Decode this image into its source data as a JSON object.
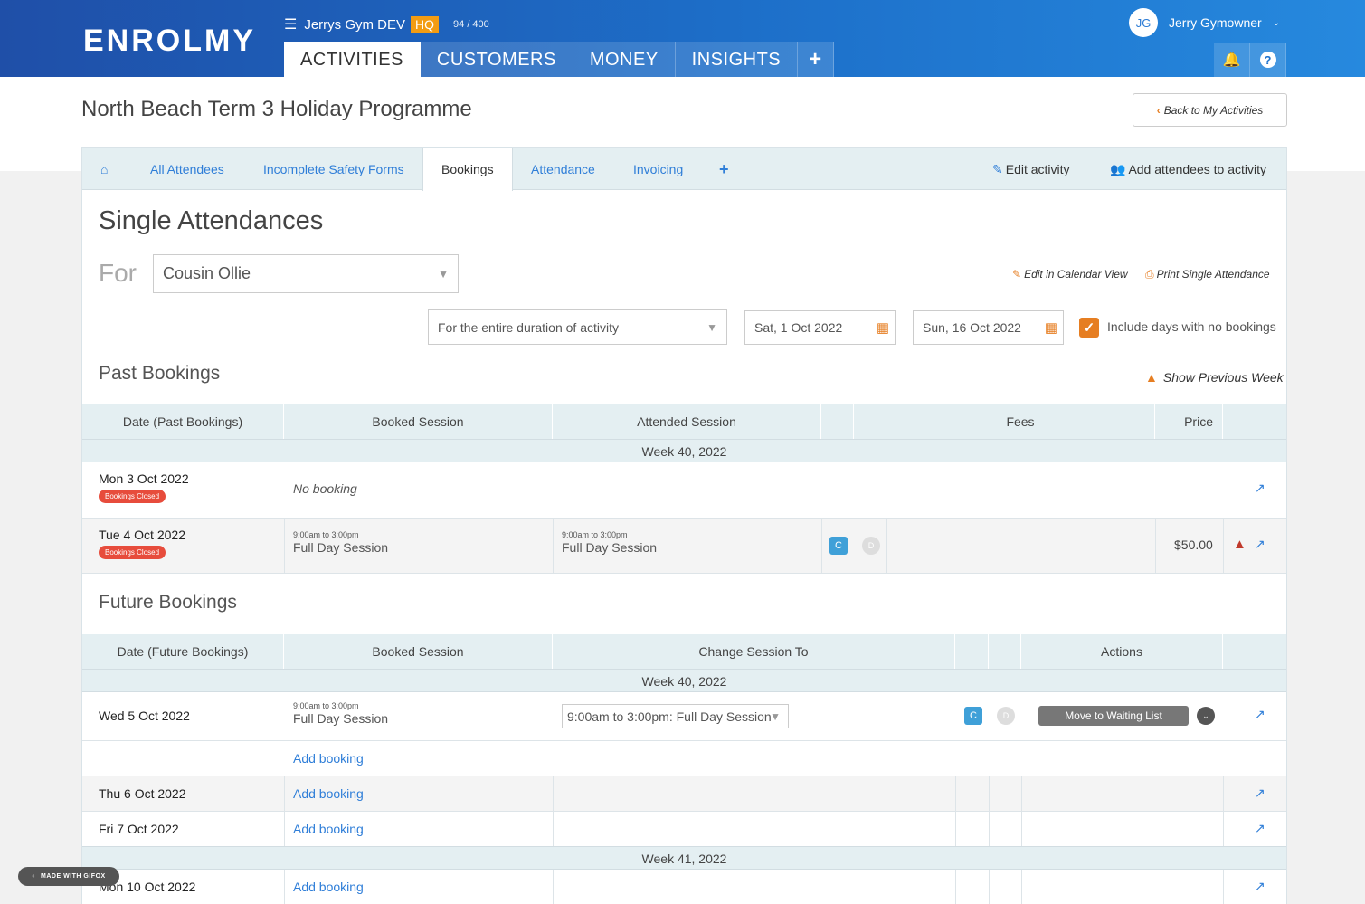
{
  "app": {
    "logo": "ENROLMY",
    "org_name": "Jerrys Gym DEV",
    "org_badge": "HQ",
    "org_count": "94 / 400",
    "nav_tabs": [
      {
        "label": "ACTIVITIES"
      },
      {
        "label": "CUSTOMERS"
      },
      {
        "label": "MONEY"
      },
      {
        "label": "INSIGHTS"
      }
    ],
    "nav_plus": "+",
    "user_initials": "JG",
    "user_name": "Jerry Gymowner",
    "help": "?"
  },
  "page": {
    "title": "North Beach Term 3 Holiday Programme",
    "back_label": "Back to My Activities"
  },
  "subtabs": {
    "items": [
      {
        "label": "All Attendees"
      },
      {
        "label": "Incomplete Safety Forms"
      },
      {
        "label": "Bookings"
      },
      {
        "label": "Attendance"
      },
      {
        "label": "Invoicing"
      }
    ],
    "plus": "+",
    "edit_activity": "Edit activity",
    "add_attendees": "Add attendees to activity"
  },
  "single": {
    "heading": "Single Attendances",
    "for_label": "For",
    "for_value": "Cousin Ollie",
    "edit_calendar": "Edit in Calendar View",
    "print": "Print Single Attendance",
    "duration": "For the entire duration of activity",
    "start_date": "Sat, 1 Oct 2022",
    "end_date": "Sun, 16 Oct 2022",
    "include_label": "Include days with no bookings"
  },
  "past": {
    "heading": "Past Bookings",
    "show_prev": "Show Previous Week",
    "headers": {
      "date": "Date (Past Bookings)",
      "booked": "Booked Session",
      "attended": "Attended Session",
      "fees": "Fees",
      "price": "Price"
    },
    "week": "Week 40, 2022",
    "rows": [
      {
        "date": "Mon 3 Oct 2022",
        "badge": "Bookings Closed",
        "booked": "No booking"
      },
      {
        "date": "Tue 4 Oct 2022",
        "badge": "Bookings Closed",
        "booked_time": "9:00am to 3:00pm",
        "booked_session": "Full Day Session",
        "attended_time": "9:00am to 3:00pm",
        "attended_session": "Full Day Session",
        "c": "C",
        "d": "D",
        "price": "$50.00"
      }
    ]
  },
  "future": {
    "heading": "Future Bookings",
    "headers": {
      "date": "Date (Future Bookings)",
      "booked": "Booked Session",
      "change": "Change Session To",
      "actions": "Actions"
    },
    "week40": "Week 40, 2022",
    "week41": "Week 41, 2022",
    "rows": [
      {
        "date": "Wed 5 Oct 2022",
        "booked_time": "9:00am to 3:00pm",
        "booked_session": "Full Day Session",
        "change_value": "9:00am to 3:00pm: Full Day Session",
        "c": "C",
        "d": "D",
        "action": "Move to Waiting List"
      },
      {
        "add": "Add booking"
      },
      {
        "date": "Thu 6 Oct 2022",
        "add": "Add booking"
      },
      {
        "date": "Fri 7 Oct 2022",
        "add": "Add booking"
      },
      {
        "date": "Mon 10 Oct 2022",
        "add": "Add booking"
      }
    ]
  },
  "watermark": "MADE WITH GIFOX"
}
